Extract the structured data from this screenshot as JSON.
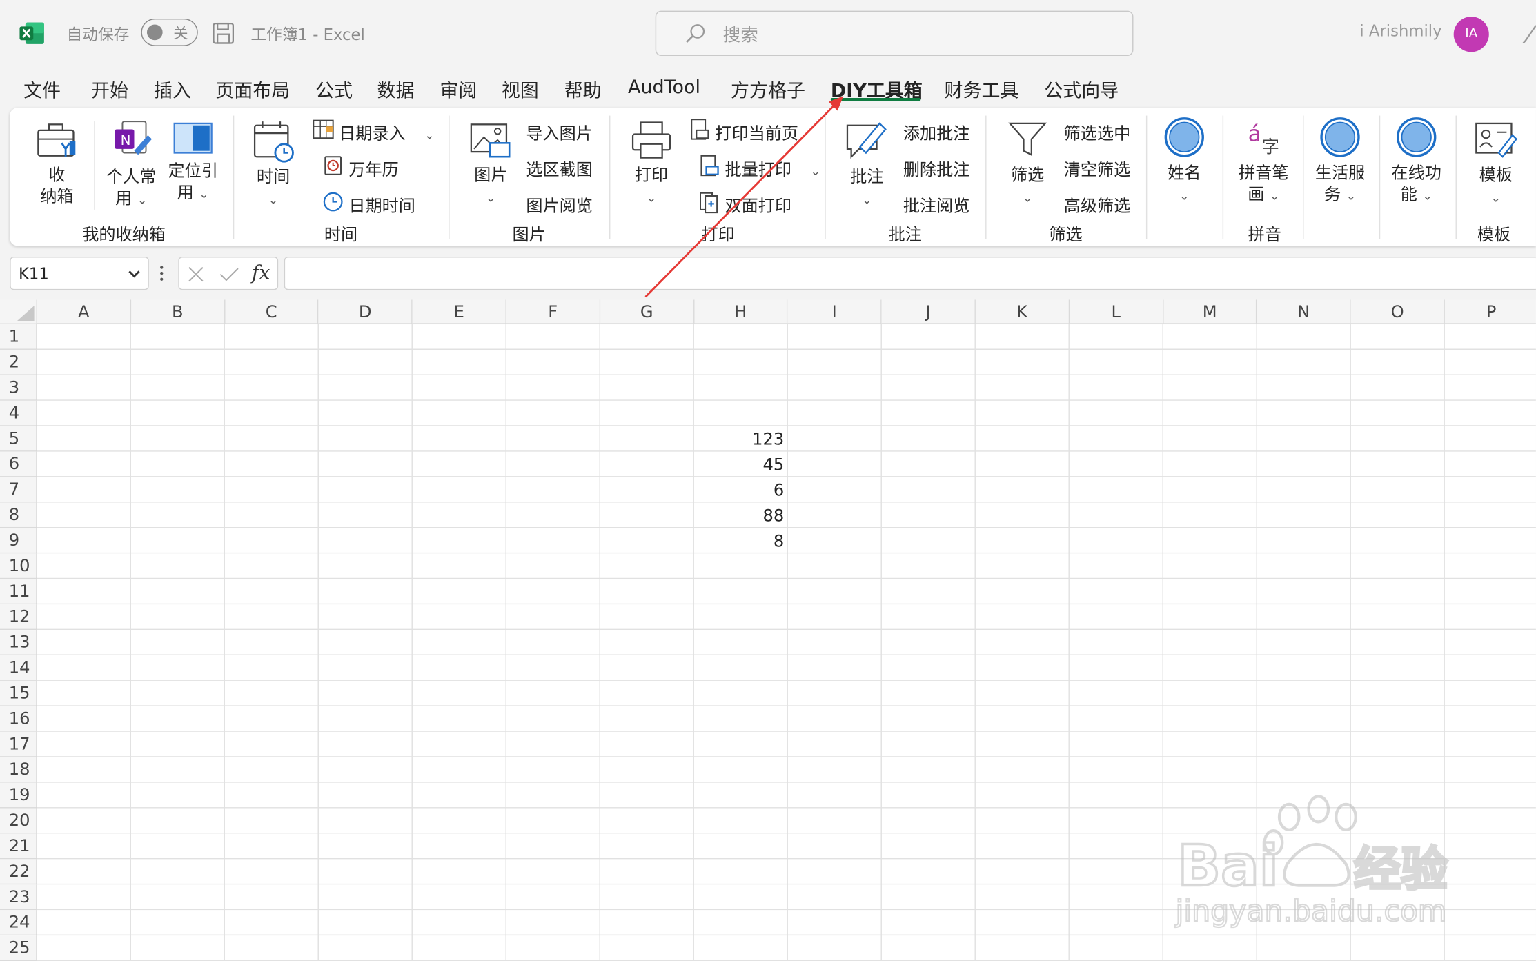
{
  "titlebar": {
    "autosave_label": "自动保存",
    "autosave_state": "关",
    "document_title": "工作簿1  -  Excel",
    "search_placeholder": "搜索",
    "username": "i Arishmily",
    "avatar_initials": "IA"
  },
  "menu": {
    "tabs": [
      {
        "label": "文件"
      },
      {
        "label": "开始"
      },
      {
        "label": "插入"
      },
      {
        "label": "页面布局"
      },
      {
        "label": "公式"
      },
      {
        "label": "数据"
      },
      {
        "label": "审阅"
      },
      {
        "label": "视图"
      },
      {
        "label": "帮助"
      },
      {
        "label": "AudTool"
      },
      {
        "label": "方方格子"
      },
      {
        "label": "DIY工具箱",
        "active": true
      },
      {
        "label": "财务工具"
      },
      {
        "label": "公式向导"
      }
    ]
  },
  "ribbon": {
    "groups": {
      "box": {
        "label": "我的收纳箱",
        "btn_storage": "收\n纳箱",
        "btn_personal_1": "个人常",
        "btn_personal_2": "用",
        "btn_locate_1": "定位引",
        "btn_locate_2": "用"
      },
      "time": {
        "label": "时间",
        "btn_time": "时间",
        "btn_date_entry": "日期录入",
        "btn_calendar": "万年历",
        "btn_datetime": "日期时间"
      },
      "picture": {
        "label": "图片",
        "btn_picture": "图片",
        "btn_import": "导入图片",
        "btn_screenshot": "选区截图",
        "btn_browse": "图片阅览"
      },
      "print": {
        "label": "打印",
        "btn_print": "打印",
        "btn_print_current": "打印当前页",
        "btn_batch_print": "批量打印",
        "btn_duplex": "双面打印"
      },
      "comment": {
        "label": "批注",
        "btn_comment": "批注",
        "btn_add": "添加批注",
        "btn_delete": "删除批注",
        "btn_review": "批注阅览"
      },
      "filter": {
        "label": "筛选",
        "btn_filter": "筛选",
        "btn_filter_selected": "筛选选中",
        "btn_clear_filter": "清空筛选",
        "btn_advanced": "高级筛选"
      },
      "name": {
        "btn_name": "姓名"
      },
      "pinyin": {
        "label": "拼音",
        "btn_pinyin_1": "拼音笔",
        "btn_pinyin_2": "画"
      },
      "life": {
        "btn_life_1": "生活服",
        "btn_life_2": "务"
      },
      "online": {
        "btn_online_1": "在线功",
        "btn_online_2": "能"
      },
      "template": {
        "label": "模板",
        "btn_template": "模板"
      }
    },
    "accent_color": "#107c41"
  },
  "formula_bar": {
    "name_box": "K11",
    "fx_label": "fx",
    "formula": ""
  },
  "sheet": {
    "columns": [
      "A",
      "B",
      "C",
      "D",
      "E",
      "F",
      "G",
      "H",
      "I",
      "J",
      "K",
      "L",
      "M",
      "N",
      "O",
      "P"
    ],
    "rows": [
      "1",
      "2",
      "3",
      "4",
      "5",
      "6",
      "7",
      "8",
      "9",
      "10",
      "11",
      "12",
      "13",
      "14",
      "15",
      "16",
      "17",
      "18",
      "19",
      "20",
      "21",
      "22",
      "23",
      "24",
      "25"
    ],
    "cells": [
      {
        "ref": "H5",
        "value": "123"
      },
      {
        "ref": "H6",
        "value": "45"
      },
      {
        "ref": "H7",
        "value": "6"
      },
      {
        "ref": "H8",
        "value": "88"
      },
      {
        "ref": "H9",
        "value": "8"
      }
    ]
  },
  "annotation": {
    "arrow_color": "#e53935"
  },
  "watermark": {
    "brand": "Bai du 经验",
    "url": "jingyan.baidu.com"
  }
}
